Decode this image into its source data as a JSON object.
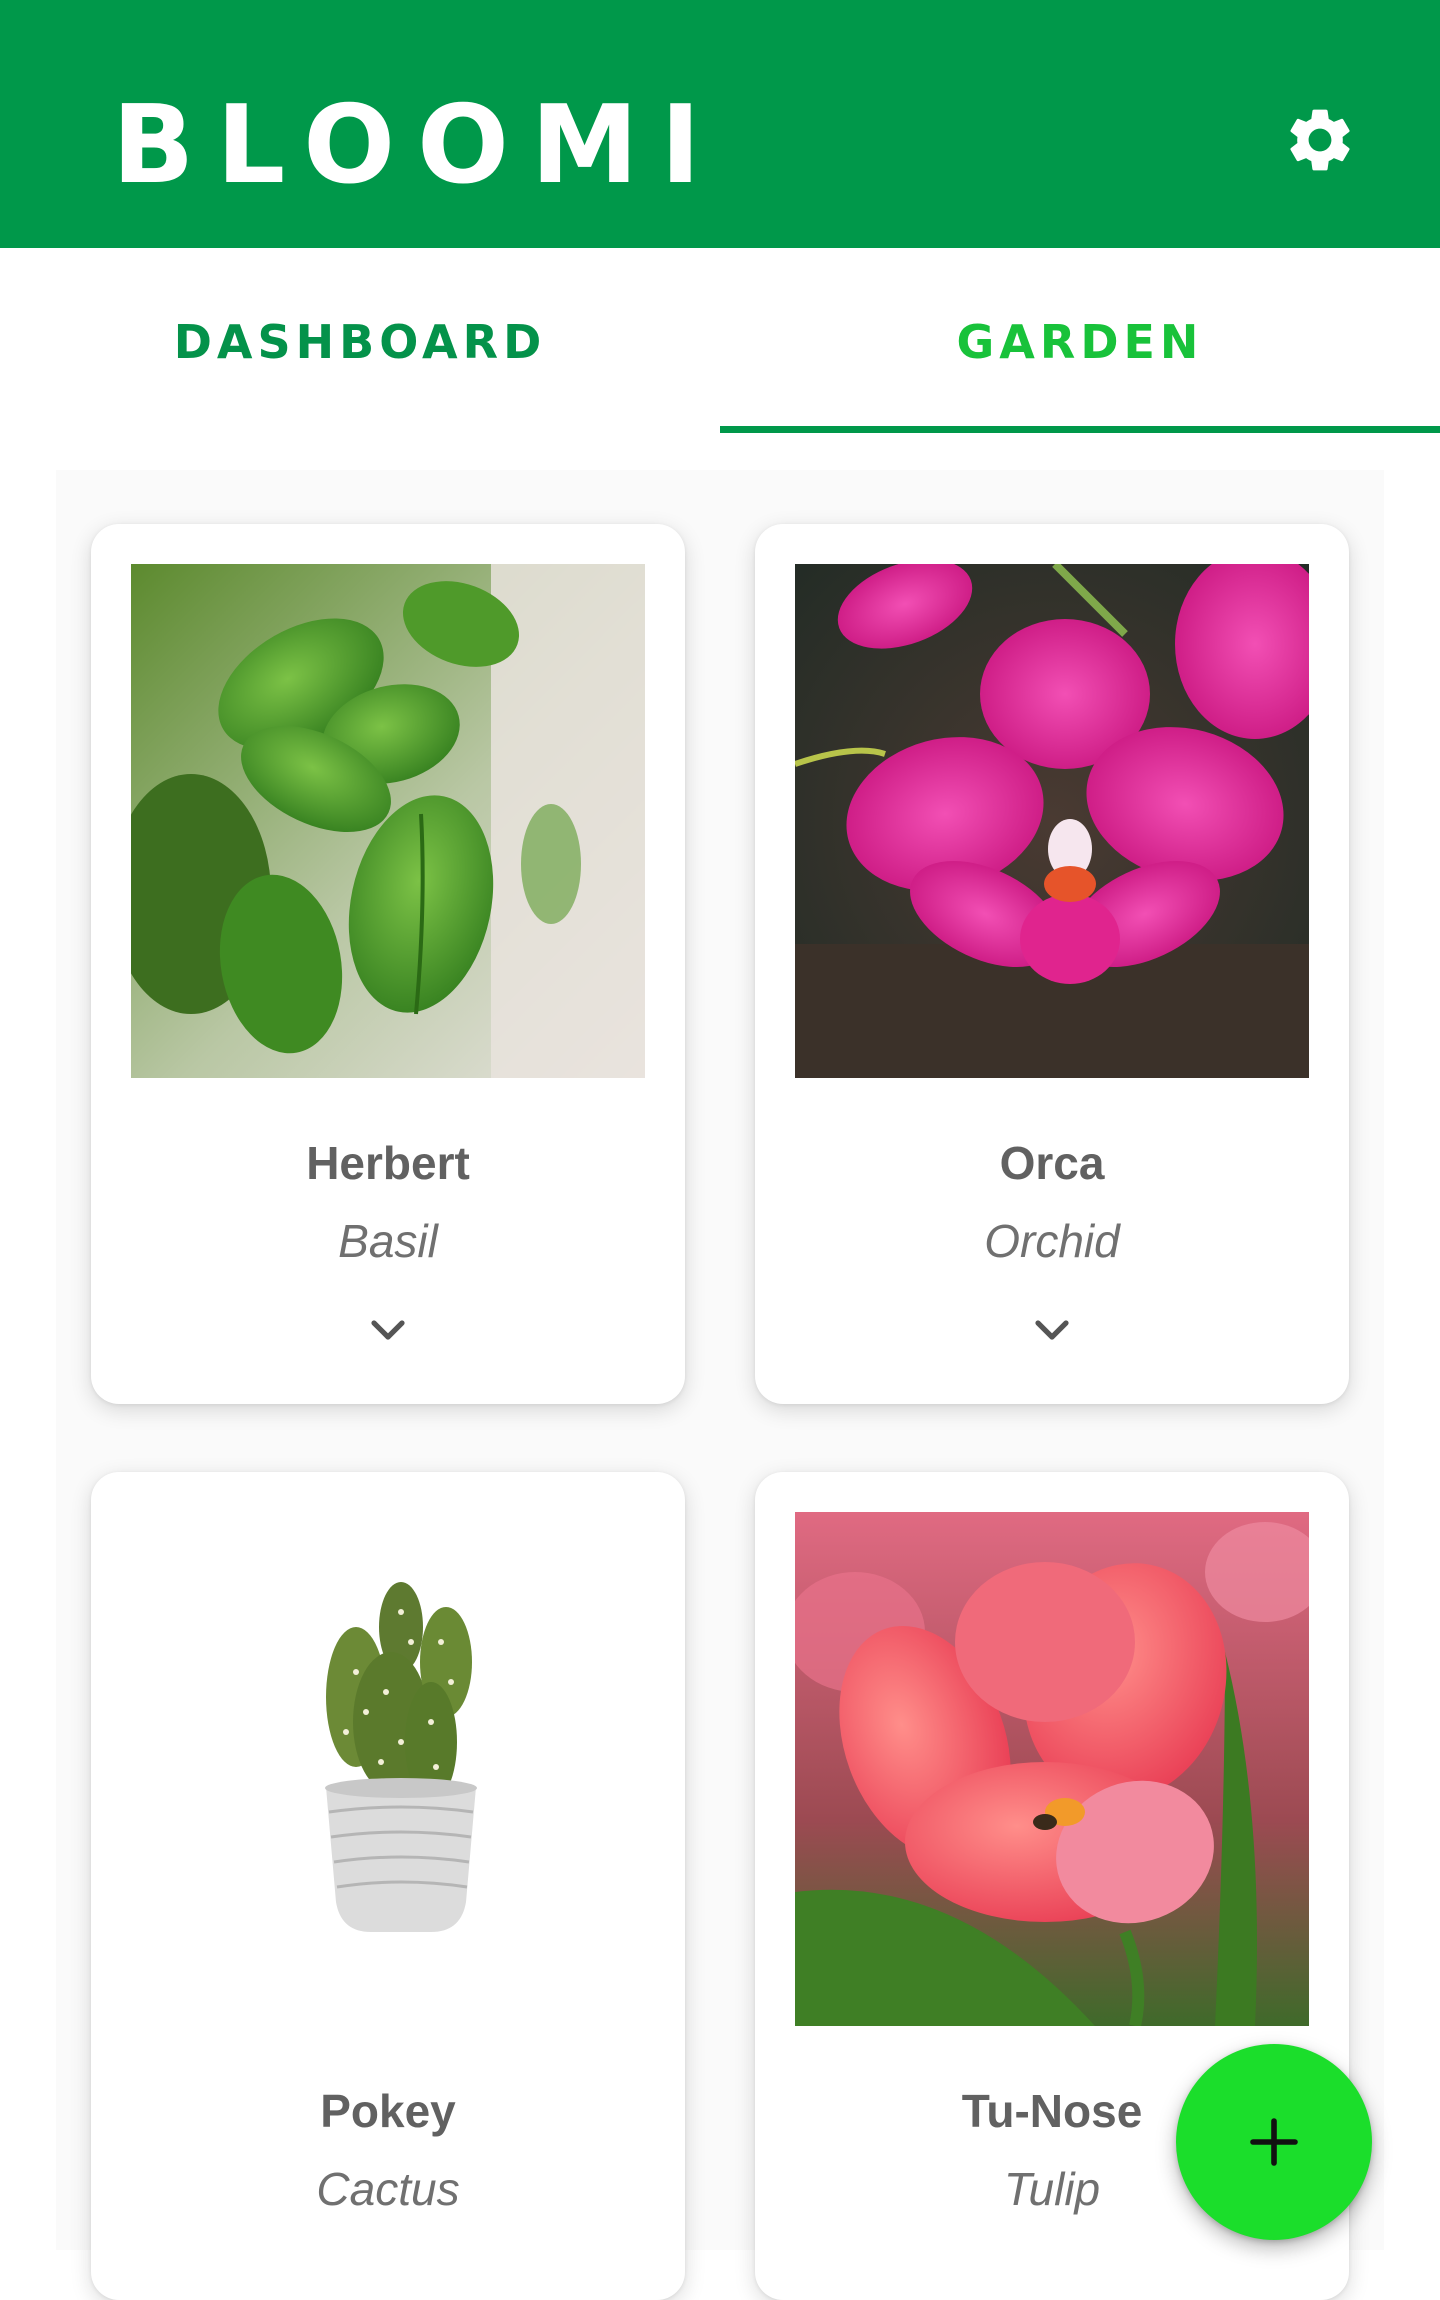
{
  "app": {
    "title": "BLOOMI",
    "settings_icon": "gear-icon",
    "brand_color": "#00984a"
  },
  "tabs": [
    {
      "label": "DASHBOARD",
      "active": false
    },
    {
      "label": "GARDEN",
      "active": true
    }
  ],
  "plants": [
    {
      "name": "Herbert",
      "species": "Basil",
      "image": "basil-photo",
      "expand_icon": "chevron-down-icon"
    },
    {
      "name": "Orca",
      "species": "Orchid",
      "image": "orchid-photo",
      "expand_icon": "chevron-down-icon"
    },
    {
      "name": "Pokey",
      "species": "Cactus",
      "image": "cactus-photo"
    },
    {
      "name": "Tu-Nose",
      "species": "Tulip",
      "image": "tulip-photo"
    }
  ],
  "fab": {
    "icon": "plus-icon",
    "color": "#1bde2b"
  }
}
